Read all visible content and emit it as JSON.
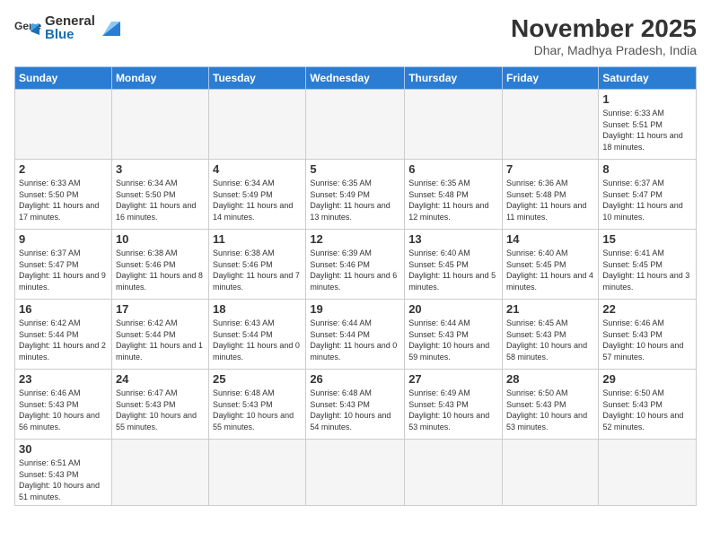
{
  "logo": {
    "text_general": "General",
    "text_blue": "Blue"
  },
  "header": {
    "month_year": "November 2025",
    "location": "Dhar, Madhya Pradesh, India"
  },
  "weekdays": [
    "Sunday",
    "Monday",
    "Tuesday",
    "Wednesday",
    "Thursday",
    "Friday",
    "Saturday"
  ],
  "weeks": [
    [
      {
        "day": "",
        "info": ""
      },
      {
        "day": "",
        "info": ""
      },
      {
        "day": "",
        "info": ""
      },
      {
        "day": "",
        "info": ""
      },
      {
        "day": "",
        "info": ""
      },
      {
        "day": "",
        "info": ""
      },
      {
        "day": "1",
        "info": "Sunrise: 6:33 AM\nSunset: 5:51 PM\nDaylight: 11 hours and 18 minutes."
      }
    ],
    [
      {
        "day": "2",
        "info": "Sunrise: 6:33 AM\nSunset: 5:50 PM\nDaylight: 11 hours and 17 minutes."
      },
      {
        "day": "3",
        "info": "Sunrise: 6:34 AM\nSunset: 5:50 PM\nDaylight: 11 hours and 16 minutes."
      },
      {
        "day": "4",
        "info": "Sunrise: 6:34 AM\nSunset: 5:49 PM\nDaylight: 11 hours and 14 minutes."
      },
      {
        "day": "5",
        "info": "Sunrise: 6:35 AM\nSunset: 5:49 PM\nDaylight: 11 hours and 13 minutes."
      },
      {
        "day": "6",
        "info": "Sunrise: 6:35 AM\nSunset: 5:48 PM\nDaylight: 11 hours and 12 minutes."
      },
      {
        "day": "7",
        "info": "Sunrise: 6:36 AM\nSunset: 5:48 PM\nDaylight: 11 hours and 11 minutes."
      },
      {
        "day": "8",
        "info": "Sunrise: 6:37 AM\nSunset: 5:47 PM\nDaylight: 11 hours and 10 minutes."
      }
    ],
    [
      {
        "day": "9",
        "info": "Sunrise: 6:37 AM\nSunset: 5:47 PM\nDaylight: 11 hours and 9 minutes."
      },
      {
        "day": "10",
        "info": "Sunrise: 6:38 AM\nSunset: 5:46 PM\nDaylight: 11 hours and 8 minutes."
      },
      {
        "day": "11",
        "info": "Sunrise: 6:38 AM\nSunset: 5:46 PM\nDaylight: 11 hours and 7 minutes."
      },
      {
        "day": "12",
        "info": "Sunrise: 6:39 AM\nSunset: 5:46 PM\nDaylight: 11 hours and 6 minutes."
      },
      {
        "day": "13",
        "info": "Sunrise: 6:40 AM\nSunset: 5:45 PM\nDaylight: 11 hours and 5 minutes."
      },
      {
        "day": "14",
        "info": "Sunrise: 6:40 AM\nSunset: 5:45 PM\nDaylight: 11 hours and 4 minutes."
      },
      {
        "day": "15",
        "info": "Sunrise: 6:41 AM\nSunset: 5:45 PM\nDaylight: 11 hours and 3 minutes."
      }
    ],
    [
      {
        "day": "16",
        "info": "Sunrise: 6:42 AM\nSunset: 5:44 PM\nDaylight: 11 hours and 2 minutes."
      },
      {
        "day": "17",
        "info": "Sunrise: 6:42 AM\nSunset: 5:44 PM\nDaylight: 11 hours and 1 minute."
      },
      {
        "day": "18",
        "info": "Sunrise: 6:43 AM\nSunset: 5:44 PM\nDaylight: 11 hours and 0 minutes."
      },
      {
        "day": "19",
        "info": "Sunrise: 6:44 AM\nSunset: 5:44 PM\nDaylight: 11 hours and 0 minutes."
      },
      {
        "day": "20",
        "info": "Sunrise: 6:44 AM\nSunset: 5:43 PM\nDaylight: 10 hours and 59 minutes."
      },
      {
        "day": "21",
        "info": "Sunrise: 6:45 AM\nSunset: 5:43 PM\nDaylight: 10 hours and 58 minutes."
      },
      {
        "day": "22",
        "info": "Sunrise: 6:46 AM\nSunset: 5:43 PM\nDaylight: 10 hours and 57 minutes."
      }
    ],
    [
      {
        "day": "23",
        "info": "Sunrise: 6:46 AM\nSunset: 5:43 PM\nDaylight: 10 hours and 56 minutes."
      },
      {
        "day": "24",
        "info": "Sunrise: 6:47 AM\nSunset: 5:43 PM\nDaylight: 10 hours and 55 minutes."
      },
      {
        "day": "25",
        "info": "Sunrise: 6:48 AM\nSunset: 5:43 PM\nDaylight: 10 hours and 55 minutes."
      },
      {
        "day": "26",
        "info": "Sunrise: 6:48 AM\nSunset: 5:43 PM\nDaylight: 10 hours and 54 minutes."
      },
      {
        "day": "27",
        "info": "Sunrise: 6:49 AM\nSunset: 5:43 PM\nDaylight: 10 hours and 53 minutes."
      },
      {
        "day": "28",
        "info": "Sunrise: 6:50 AM\nSunset: 5:43 PM\nDaylight: 10 hours and 53 minutes."
      },
      {
        "day": "29",
        "info": "Sunrise: 6:50 AM\nSunset: 5:43 PM\nDaylight: 10 hours and 52 minutes."
      }
    ],
    [
      {
        "day": "30",
        "info": "Sunrise: 6:51 AM\nSunset: 5:43 PM\nDaylight: 10 hours and 51 minutes."
      },
      {
        "day": "",
        "info": ""
      },
      {
        "day": "",
        "info": ""
      },
      {
        "day": "",
        "info": ""
      },
      {
        "day": "",
        "info": ""
      },
      {
        "day": "",
        "info": ""
      },
      {
        "day": "",
        "info": ""
      }
    ]
  ]
}
